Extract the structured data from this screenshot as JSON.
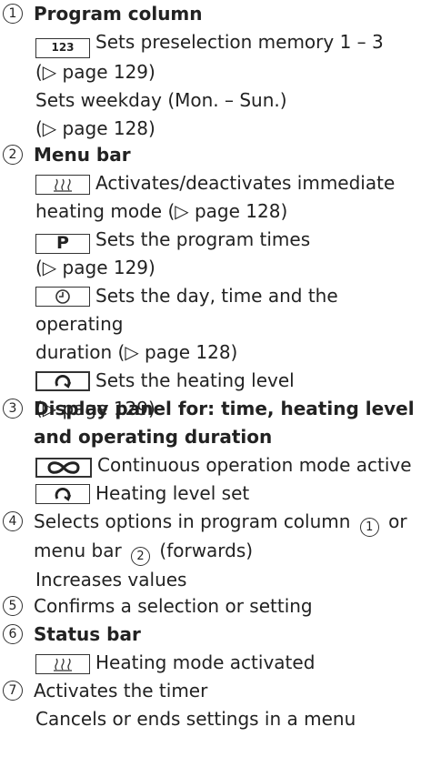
{
  "items": [
    {
      "num": "1",
      "title": "Program column",
      "lines": [
        {
          "sym": "123",
          "text": "Sets preselection memory 1 – 3"
        },
        {
          "text": "(▷ page 129)"
        },
        {
          "text": "Sets weekday (Mon. – Sun.)"
        },
        {
          "text": "(▷ page 128)"
        }
      ]
    },
    {
      "num": "2",
      "title": "Menu bar",
      "lines": [
        {
          "icon": "heating-icon",
          "text": "Activates/deactivates immediate"
        },
        {
          "text": "heating mode (▷ page 128)"
        },
        {
          "sym": "P",
          "text": "Sets the program times"
        },
        {
          "text": "(▷ page 129)"
        },
        {
          "icon": "clock-icon",
          "text": "Sets the day, time and the operating"
        },
        {
          "text": "duration (▷ page 128)"
        },
        {
          "icon": "heating-level-icon",
          "text": "Sets the heating level"
        },
        {
          "text": "(▷ page 129)"
        }
      ]
    },
    {
      "num": "3",
      "title_line1": "Display panel for: time, heating level",
      "title_line2": "and operating duration",
      "lines": [
        {
          "icon": "continuous-icon",
          "text": "Continuous operation mode active"
        },
        {
          "icon": "heating-level-icon",
          "text": "Heating level set"
        }
      ]
    },
    {
      "num": "4",
      "text_part1": "Selects options in program column",
      "ref1": "1",
      "text_part2": "or",
      "text_part3": "menu bar",
      "ref2": "2",
      "text_part4": "(forwards)",
      "line3": "Increases values"
    },
    {
      "num": "5",
      "text": "Confirms a selection or setting"
    },
    {
      "num": "6",
      "title": "Status bar",
      "lines": [
        {
          "icon": "heating-icon",
          "text": "Heating mode activated"
        }
      ]
    },
    {
      "num": "7",
      "line1": "Activates the timer",
      "line2": "Cancels or ends settings in a menu"
    }
  ]
}
